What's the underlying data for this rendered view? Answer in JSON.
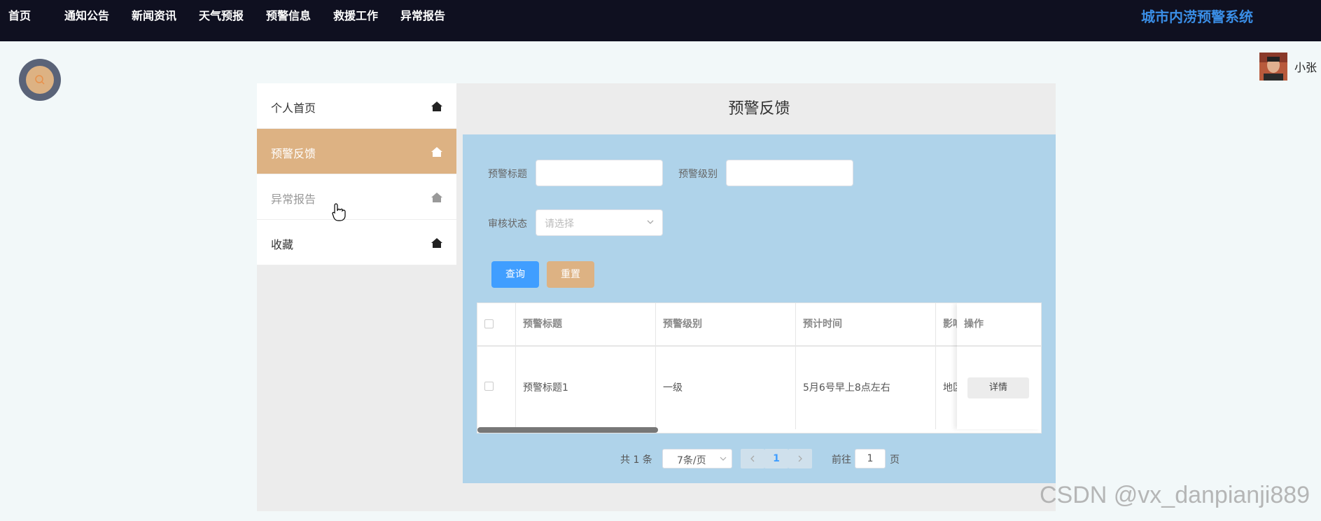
{
  "nav": {
    "items": [
      "首页",
      "通知公告",
      "新闻资讯",
      "天气预报",
      "预警信息",
      "救援工作",
      "异常报告"
    ],
    "site_title": "城市内涝预警系统"
  },
  "user": {
    "name": "小张"
  },
  "sidebar": {
    "items": [
      {
        "label": "个人首页"
      },
      {
        "label": "预警反馈"
      },
      {
        "label": "异常报告"
      },
      {
        "label": "收藏"
      }
    ]
  },
  "page": {
    "title": "预警反馈"
  },
  "filters": {
    "title_label": "预警标题",
    "title_value": "",
    "level_label": "预警级别",
    "level_value": "",
    "status_label": "审核状态",
    "status_placeholder": "请选择"
  },
  "buttons": {
    "query": "查询",
    "reset": "重置"
  },
  "table": {
    "headers": [
      "预警标题",
      "预警级别",
      "预计时间",
      "影响",
      "操作"
    ],
    "rows": [
      {
        "title": "预警标题1",
        "level": "一级",
        "time": "5月6号早上8点左右",
        "impact": "地区",
        "action": "详情"
      }
    ]
  },
  "pagination": {
    "total": "共 1 条",
    "page_size": "7条/页",
    "current_page": "1",
    "goto_label": "前往",
    "goto_value": "1",
    "page_unit": "页"
  },
  "watermark": "CSDN @vx_danpianji889",
  "colors": {
    "topbar": "#0f1020",
    "accent": "#ddb283",
    "primary": "#409eff",
    "panel": "#afd3ea",
    "title": "#3a8ee6"
  }
}
